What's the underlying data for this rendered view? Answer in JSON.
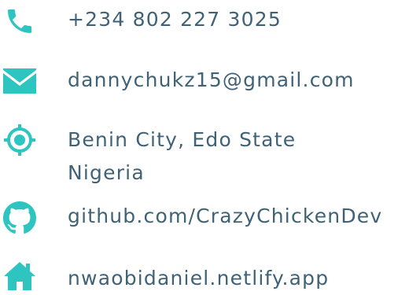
{
  "accent": "#2ec5c1",
  "text_color": "#3f6276",
  "contacts": {
    "phone": {
      "icon": "phone-icon",
      "text": "+234 802 227 3025"
    },
    "email": {
      "icon": "envelope-icon",
      "text": "dannychukz15@gmail.com"
    },
    "location": {
      "icon": "location-target-icon",
      "line1": "Benin City, Edo State",
      "line2": "Nigeria"
    },
    "github": {
      "icon": "github-icon",
      "text": "github.com/CrazyChickenDev"
    },
    "website": {
      "icon": "home-icon",
      "text": "nwaobidaniel.netlify.app"
    }
  }
}
